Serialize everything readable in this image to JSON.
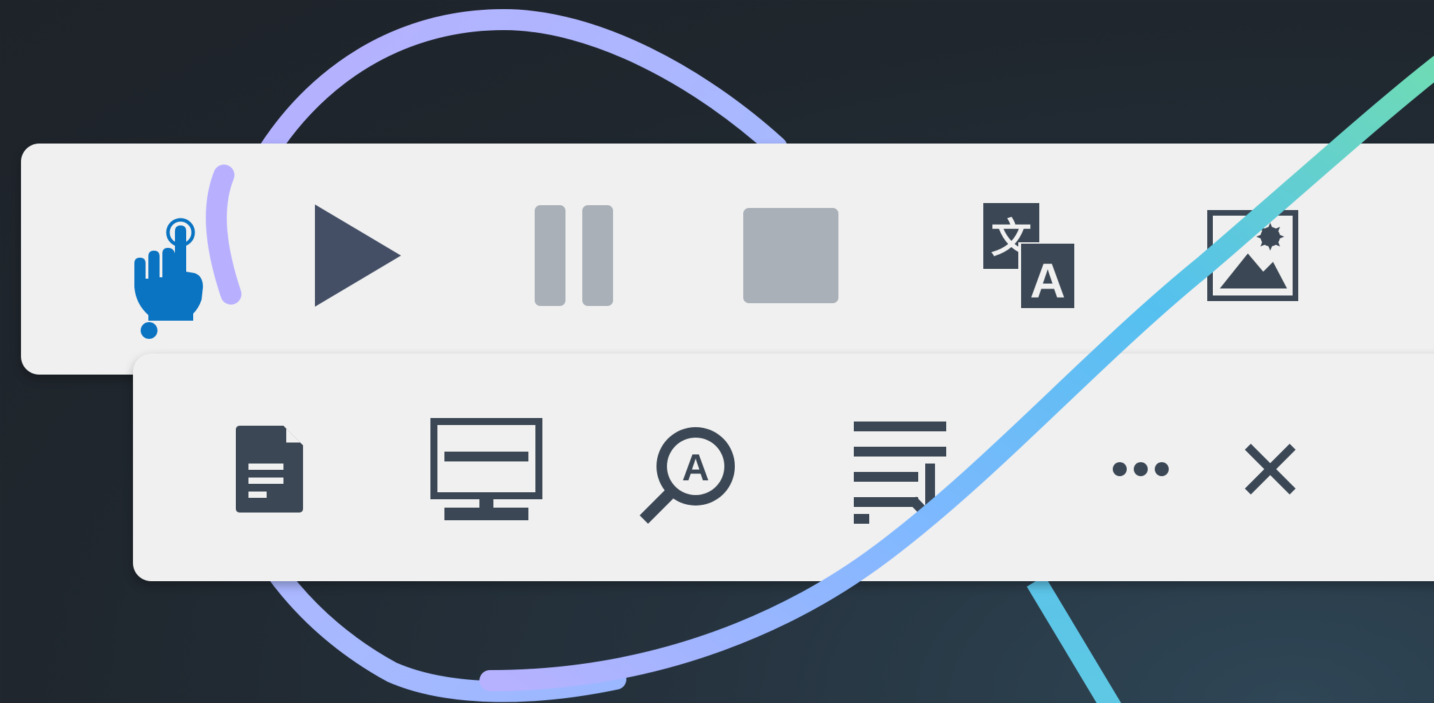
{
  "colors": {
    "toolbar_bg": "#f0f0f0",
    "icon_dark": "#3b4754",
    "icon_disabled": "#aab0b8",
    "accent_blue": "#0a73c2",
    "ribbon_purple": "#b7b2ff",
    "ribbon_blue": "#5bbcf7",
    "ribbon_green": "#6ad8bb"
  },
  "toolbar_top": {
    "buttons": [
      {
        "id": "click-and-listen",
        "icon": "pointing-hand-icon",
        "state": "active"
      },
      {
        "id": "play",
        "icon": "play-icon",
        "state": "enabled"
      },
      {
        "id": "pause",
        "icon": "pause-icon",
        "state": "disabled"
      },
      {
        "id": "stop",
        "icon": "stop-icon",
        "state": "disabled"
      },
      {
        "id": "translate",
        "icon": "translate-icon",
        "state": "enabled"
      },
      {
        "id": "picture",
        "icon": "image-icon",
        "state": "enabled"
      }
    ]
  },
  "toolbar_bottom": {
    "buttons": [
      {
        "id": "document",
        "icon": "document-icon",
        "state": "enabled"
      },
      {
        "id": "screen",
        "icon": "monitor-icon",
        "state": "enabled"
      },
      {
        "id": "text-finder",
        "icon": "magnifier-a-icon",
        "state": "enabled"
      },
      {
        "id": "text-extract",
        "icon": "lines-arrow-down-icon",
        "state": "enabled"
      },
      {
        "id": "more",
        "icon": "more-icon",
        "state": "enabled"
      },
      {
        "id": "close",
        "icon": "close-icon",
        "state": "enabled"
      }
    ]
  }
}
